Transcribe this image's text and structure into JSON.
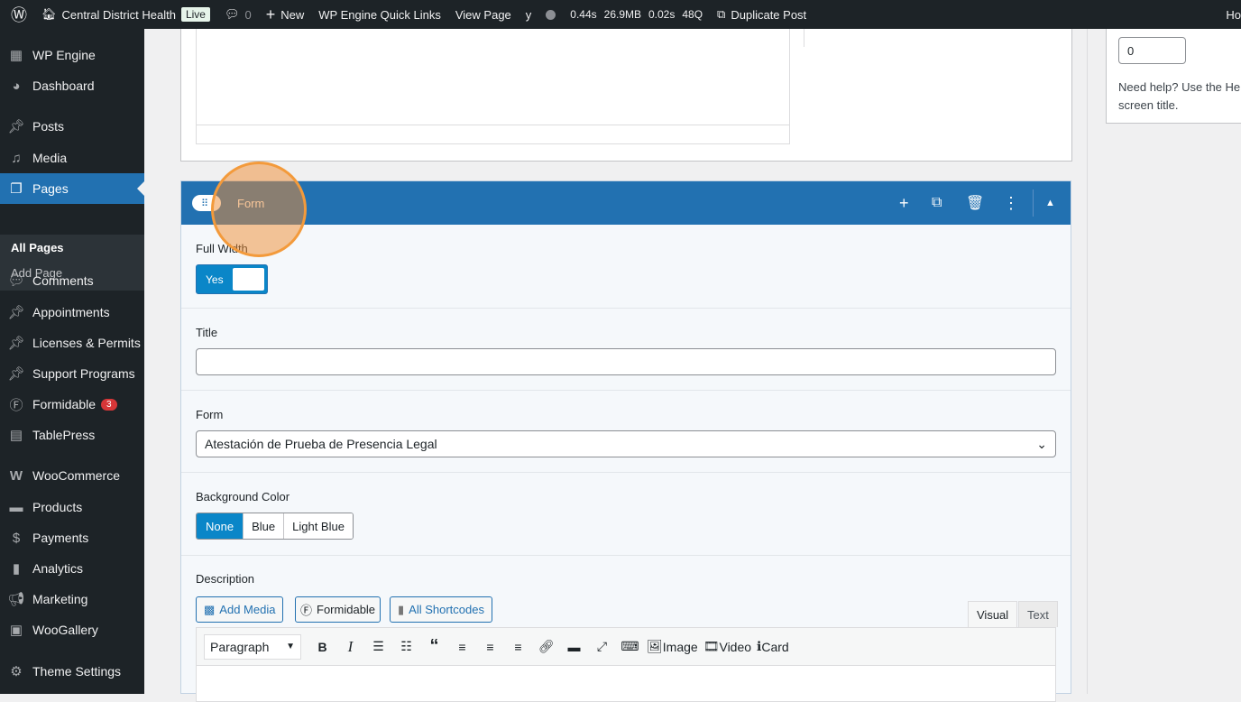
{
  "adminbar": {
    "site": "Central District Health",
    "live": "Live",
    "comments": "0",
    "new": "New",
    "quick_links": "WP Engine Quick Links",
    "view_page": "View Page",
    "perf": [
      "0.44s",
      "26.9MB",
      "0.02s",
      "48Q"
    ],
    "duplicate": "Duplicate Post",
    "howdy": "Ho"
  },
  "sidebar": {
    "items": [
      {
        "label": "WP Engine",
        "icon": "grid-icon"
      },
      {
        "label": "Dashboard",
        "icon": "gauge-icon"
      },
      {
        "label": "Posts",
        "icon": "pin-icon"
      },
      {
        "label": "Media",
        "icon": "media-icon"
      },
      {
        "label": "Pages",
        "icon": "pages-icon"
      },
      {
        "label": "Comments",
        "icon": "comment-icon"
      },
      {
        "label": "Appointments",
        "icon": "pin-icon"
      },
      {
        "label": "Licenses & Permits",
        "icon": "pin-icon"
      },
      {
        "label": "Support Programs",
        "icon": "pin-icon"
      },
      {
        "label": "Formidable",
        "icon": "formidable-icon",
        "badge": "3"
      },
      {
        "label": "TablePress",
        "icon": "table-icon"
      },
      {
        "label": "WooCommerce",
        "icon": "woo-icon"
      },
      {
        "label": "Products",
        "icon": "box-icon"
      },
      {
        "label": "Payments",
        "icon": "dollar-icon"
      },
      {
        "label": "Analytics",
        "icon": "chart-icon"
      },
      {
        "label": "Marketing",
        "icon": "megaphone-icon"
      },
      {
        "label": "WooGallery",
        "icon": "gallery-icon"
      },
      {
        "label": "Theme Settings",
        "icon": "gear-icon"
      }
    ],
    "sub": [
      "All Pages",
      "Add Page"
    ]
  },
  "right": {
    "value": "0",
    "help": "Need help? Use the Help",
    "help2": "screen title."
  },
  "block": {
    "title": "Form",
    "full_width_label": "Full Width",
    "toggle": "Yes",
    "title_label": "Title",
    "title_value": "",
    "form_label": "Form",
    "form_value": "Atestación de Prueba de Presencia Legal",
    "bg_label": "Background Color",
    "bg_options": [
      "None",
      "Blue",
      "Light Blue"
    ],
    "desc_label": "Description",
    "add_media": "Add Media",
    "formidable": "Formidable",
    "shortcodes": "All Shortcodes",
    "visual": "Visual",
    "text": "Text",
    "paragraph": "Paragraph",
    "image": "Image",
    "video": "Video",
    "card": "Card"
  }
}
